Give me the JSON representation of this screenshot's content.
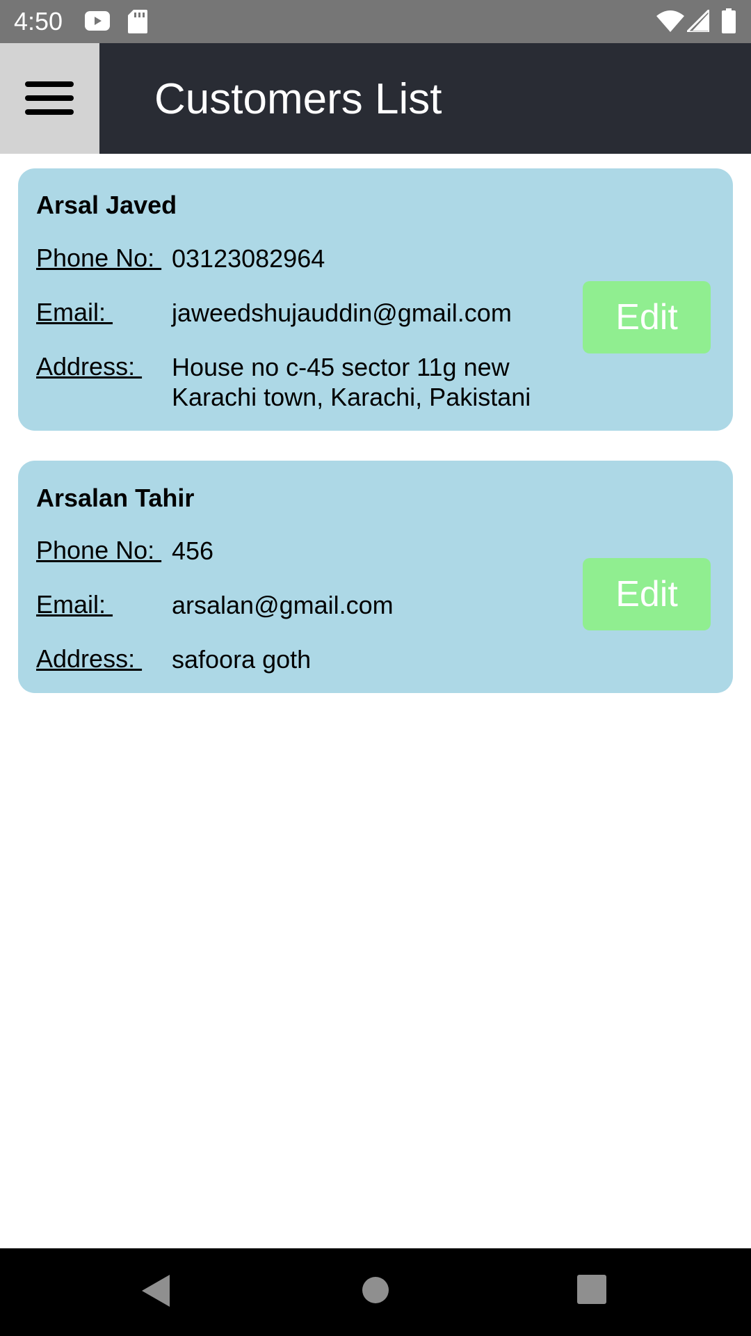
{
  "status_bar": {
    "time": "4:50",
    "icons": [
      "youtube-icon",
      "sd-card-icon",
      "wifi-icon",
      "signal-icon",
      "battery-icon"
    ]
  },
  "app_bar": {
    "title": "Customers List",
    "menu_icon": "hamburger-menu-icon"
  },
  "customers": [
    {
      "name": "Arsal Javed",
      "phone_label": "Phone No: ",
      "phone": "03123082964",
      "email_label": "Email: ",
      "email": "jaweedshujauddin@gmail.com",
      "address_label": "Address: ",
      "address": "House no c-45 sector 11g new Karachi town, Karachi, Pakistani",
      "edit_label": "Edit"
    },
    {
      "name": "Arsalan Tahir",
      "phone_label": "Phone No: ",
      "phone": "456",
      "email_label": "Email: ",
      "email": "arsalan@gmail.com",
      "address_label": "Address: ",
      "address": "safoora goth",
      "edit_label": "Edit"
    }
  ],
  "nav_bar": {
    "icons": [
      "back-icon",
      "home-icon",
      "recents-icon"
    ]
  },
  "colors": {
    "status_bar": "#767676",
    "app_bar": "#292c34",
    "menu_button": "#d3d3d3",
    "card": "#add8e6",
    "edit_button": "#90ee90",
    "nav_bar": "#000000"
  }
}
